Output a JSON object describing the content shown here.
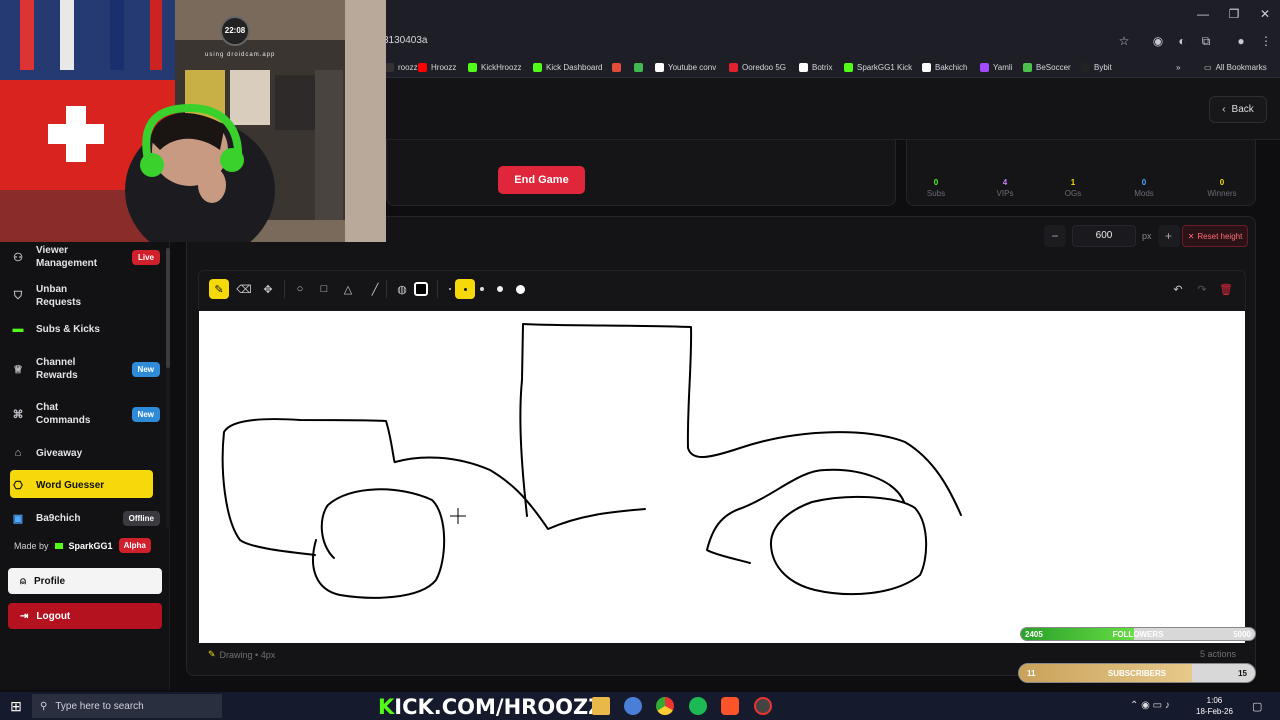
{
  "browser": {
    "url_fragment": "3130403a",
    "bookmarks": [
      {
        "label": "roozz",
        "color": "#333"
      },
      {
        "label": "Hroozz",
        "color": "#ff0000"
      },
      {
        "label": "KickHroozz",
        "color": "#53fc18"
      },
      {
        "label": "Kick Dashboard",
        "color": "#53fc18"
      },
      {
        "label": "",
        "color": "#e34b3a"
      },
      {
        "label": "",
        "color": "#3fb950"
      },
      {
        "label": "Youtube conv",
        "color": "#ffffff"
      },
      {
        "label": "Ooredoo 5G",
        "color": "#e3202f"
      },
      {
        "label": "Botrix",
        "color": "#ffffff"
      },
      {
        "label": "SparkGG1 Kick",
        "color": "#53fc18"
      },
      {
        "label": "Bakchich",
        "color": "#ffffff"
      },
      {
        "label": "Yamli",
        "color": "#a24bff"
      },
      {
        "label": "BeSoccer",
        "color": "#4cc24c"
      },
      {
        "label": "Bybit",
        "color": "#222"
      }
    ],
    "all_bookmarks_label": "All Bookmarks"
  },
  "header": {
    "back_label": "Back"
  },
  "game": {
    "end_game_label": "End Game"
  },
  "stats": [
    {
      "value": "0",
      "label": "Subs",
      "color": "#53fc18"
    },
    {
      "value": "4",
      "label": "VIPs",
      "color": "#c77dff"
    },
    {
      "value": "1",
      "label": "OGs",
      "color": "#f5d90a"
    },
    {
      "value": "0",
      "label": "Mods",
      "color": "#4ea8ff"
    },
    {
      "value": "0",
      "label": "Winners",
      "color": "#f5d90a"
    }
  ],
  "canvas": {
    "height_value": "600",
    "height_unit": "px",
    "reset_label": "Reset height",
    "status_left": "Drawing • 4px",
    "status_right": "5 actions"
  },
  "sidebar": {
    "items": [
      {
        "label": "Viewer Management",
        "badge": "Live",
        "badge_color": "#d0202c"
      },
      {
        "label": "Unban Requests",
        "badge": "",
        "badge_color": ""
      },
      {
        "label": "Subs & Kicks",
        "badge": "",
        "badge_color": ""
      },
      {
        "label": "Channel Rewards",
        "badge": "New",
        "badge_color": "#2f8bd8"
      },
      {
        "label": "Chat Commands",
        "badge": "New",
        "badge_color": "#2f8bd8"
      },
      {
        "label": "Giveaway",
        "badge": "",
        "badge_color": ""
      },
      {
        "label": "Word Guesser",
        "badge": "",
        "badge_color": ""
      },
      {
        "label": "Ba9chich",
        "badge": "Offline",
        "badge_color": "#3a3a40"
      }
    ],
    "made_by_prefix": "Made by",
    "made_by_name": "SparkGG1",
    "made_by_badge": "Alpha",
    "profile_label": "Profile",
    "logout_label": "Logout"
  },
  "webcam": {
    "clock": "22:08",
    "watermark": "using droidcam.app"
  },
  "overlay": {
    "followers": {
      "current": "2405",
      "label": "FOLLOWERS",
      "goal": "5000",
      "progress": 0.481
    },
    "subscribers": {
      "current": "11",
      "label": "SUBSCRIBERS",
      "goal": "15",
      "progress": 0.733
    }
  },
  "taskbar": {
    "search_placeholder": "Type here to search",
    "banner_prefix": "K",
    "banner_rest": "ICK.COM/HROOZZ",
    "time": "1:06",
    "date": "18-Feb-26"
  },
  "colors": {
    "accent": "#f5d90a",
    "danger": "#e0263a",
    "kick_green": "#53fc18"
  }
}
